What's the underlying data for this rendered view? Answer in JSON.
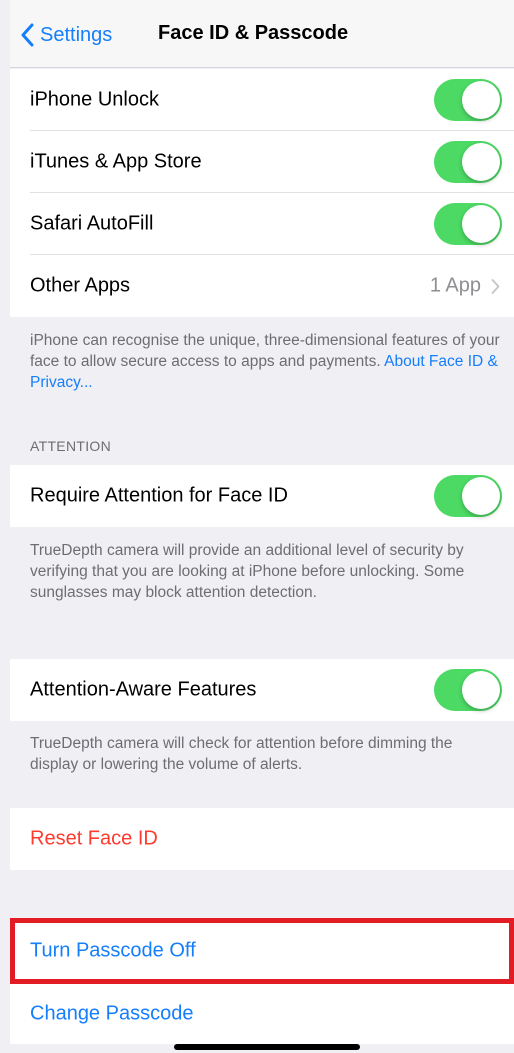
{
  "nav": {
    "back_label": "Settings",
    "title": "Face ID & Passcode"
  },
  "use_face_id_for": {
    "items": [
      {
        "label": "iPhone Unlock",
        "toggle_on": true
      },
      {
        "label": "iTunes & App Store",
        "toggle_on": true
      },
      {
        "label": "Safari AutoFill",
        "toggle_on": true
      }
    ],
    "other_apps": {
      "label": "Other Apps",
      "detail": "1 App"
    },
    "footer": {
      "text": "iPhone can recognise the unique, three-dimensional features of your face to allow secure access to apps and payments. ",
      "link": "About Face ID & Privacy..."
    }
  },
  "attention": {
    "header": "ATTENTION",
    "require": {
      "label": "Require Attention for Face ID",
      "toggle_on": true,
      "footer": "TrueDepth camera will provide an additional level of security by verifying that you are looking at iPhone before unlocking. Some sunglasses may block attention detection."
    },
    "aware": {
      "label": "Attention-Aware Features",
      "toggle_on": true,
      "footer": "TrueDepth camera will check for attention before dimming the display or lowering the volume of alerts."
    }
  },
  "actions": {
    "reset_face_id": "Reset Face ID",
    "turn_passcode_off": "Turn Passcode Off",
    "change_passcode": "Change Passcode"
  },
  "colors": {
    "accent": "#157efb",
    "toggle_on": "#4cd964",
    "destructive": "#ff3b30",
    "highlight": "#e31b23",
    "grouped_background": "#efeff4"
  }
}
